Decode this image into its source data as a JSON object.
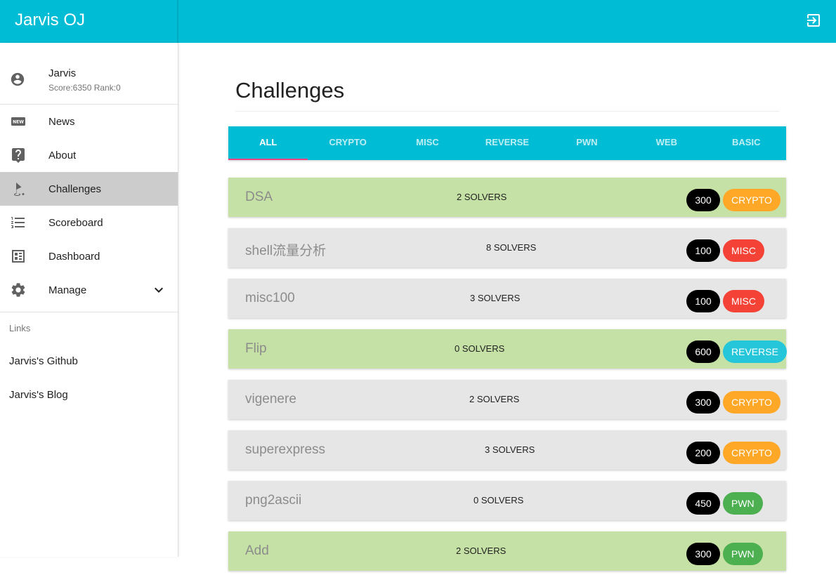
{
  "app": {
    "title": "Jarvis OJ"
  },
  "header": {
    "logout_icon": "logout-icon"
  },
  "user": {
    "name": "Jarvis",
    "score_rank": "Score:6350 Rank:0"
  },
  "nav": [
    {
      "label": "News",
      "icon": "news-icon"
    },
    {
      "label": "About",
      "icon": "help-icon"
    },
    {
      "label": "Challenges",
      "icon": "golf-flag-icon"
    },
    {
      "label": "Scoreboard",
      "icon": "list-icon"
    },
    {
      "label": "Dashboard",
      "icon": "dashboard-icon"
    },
    {
      "label": "Manage",
      "icon": "gear-icon"
    }
  ],
  "links": {
    "header": "Links",
    "items": [
      "Jarvis's Github",
      "Jarvis's Blog"
    ]
  },
  "page": {
    "title": "Challenges"
  },
  "tabs": [
    "ALL",
    "CRYPTO",
    "MISC",
    "REVERSE",
    "PWN",
    "WEB",
    "BASIC"
  ],
  "colors": {
    "primary": "#00bcd4",
    "solved": "#c5e1a5",
    "unsolved": "#e6e6e6",
    "indicator": "#ff4081",
    "CRYPTO": "#ffa726",
    "MISC": "#f44336",
    "REVERSE": "#26c6da",
    "PWN": "#4caf50"
  },
  "challenges": [
    {
      "name": "DSA",
      "solvers": "2 SOLVERS",
      "score": "300",
      "category": "CRYPTO",
      "solved": true
    },
    {
      "name": "shell流量分析",
      "solvers": "8 SOLVERS",
      "score": "100",
      "category": "MISC",
      "solved": false
    },
    {
      "name": "misc100",
      "solvers": "3 SOLVERS",
      "score": "100",
      "category": "MISC",
      "solved": false
    },
    {
      "name": "Flip",
      "solvers": "0 SOLVERS",
      "score": "600",
      "category": "REVERSE",
      "solved": true
    },
    {
      "name": "vigenere",
      "solvers": "2 SOLVERS",
      "score": "300",
      "category": "CRYPTO",
      "solved": false
    },
    {
      "name": "superexpress",
      "solvers": "3 SOLVERS",
      "score": "200",
      "category": "CRYPTO",
      "solved": false
    },
    {
      "name": "png2ascii",
      "solvers": "0 SOLVERS",
      "score": "450",
      "category": "PWN",
      "solved": false
    },
    {
      "name": "Add",
      "solvers": "2 SOLVERS",
      "score": "300",
      "category": "PWN",
      "solved": true
    }
  ]
}
